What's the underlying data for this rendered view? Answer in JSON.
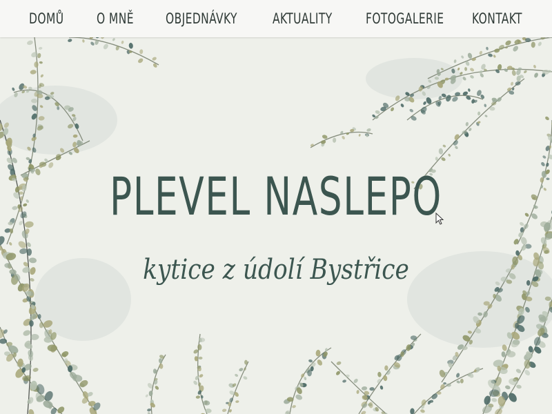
{
  "nav": {
    "items": [
      {
        "label": "DOMŮ"
      },
      {
        "label": "O MNĚ"
      },
      {
        "label": "OBJEDNÁVKY"
      },
      {
        "label": "AKTUALITY"
      },
      {
        "label": "FOTOGALERIE"
      },
      {
        "label": "KONTAKT"
      }
    ]
  },
  "hero": {
    "title": "PLEVEL NASLEPO",
    "subtitle": "kytice z údolí Bystřice",
    "background_art": "watercolor-botanical-branches"
  },
  "colors": {
    "text": "#3c5650",
    "nav_background": "#f7f7f5",
    "page_background": "#eef0ea",
    "foliage_olive": "#8f9668",
    "foliage_sage": "#9cab9a",
    "foliage_teal": "#4d6a66"
  }
}
